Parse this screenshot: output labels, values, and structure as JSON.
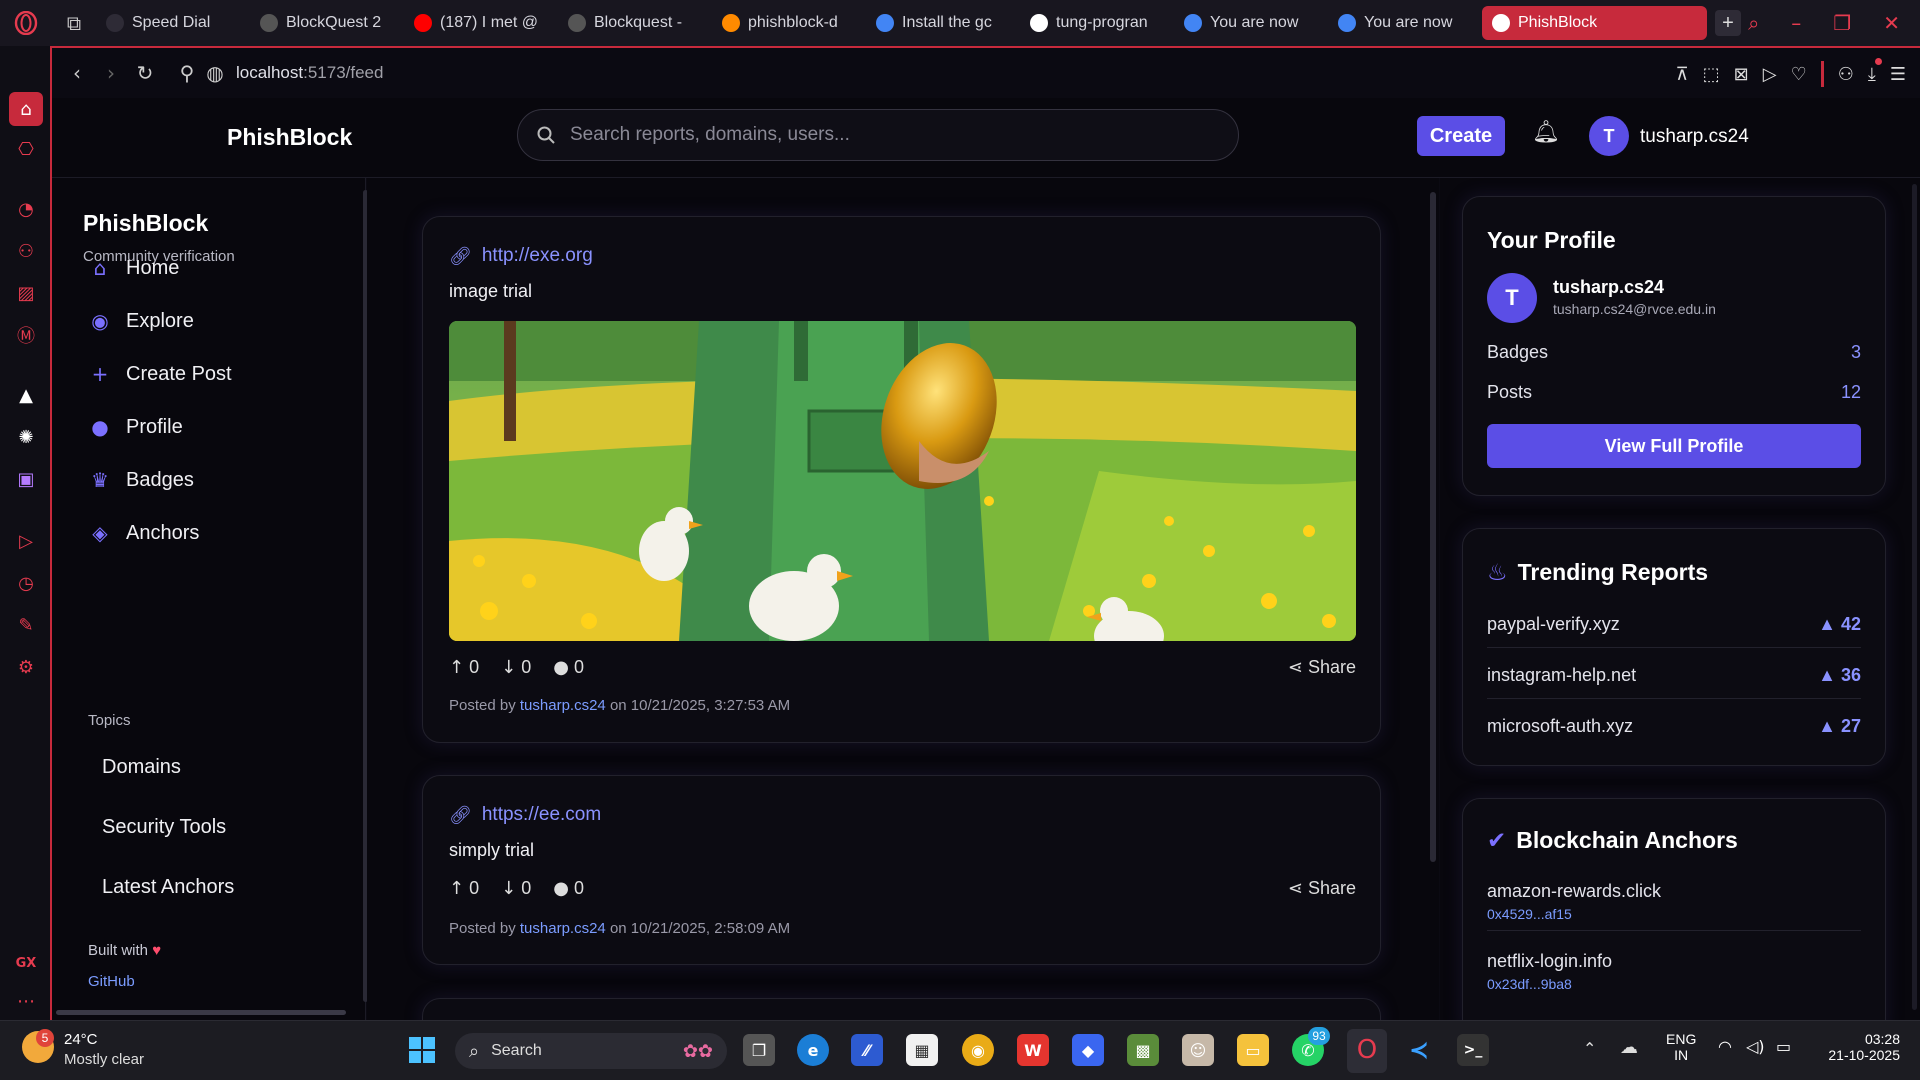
{
  "browser": {
    "tabs": [
      {
        "label": "Speed Dial",
        "icon": "grid-icon",
        "color": "#2e2b36"
      },
      {
        "label": "BlockQuest 2",
        "icon": "openai-icon",
        "color": "#555"
      },
      {
        "label": "(187) I met @",
        "icon": "youtube-icon",
        "color": "#ff0000"
      },
      {
        "label": "Blockquest -",
        "icon": "openai-icon",
        "color": "#555"
      },
      {
        "label": "phishblock-d",
        "icon": "firebase-icon",
        "color": "#ff8a00"
      },
      {
        "label": "Install the gc",
        "icon": "gcloud-icon",
        "color": "#4285f4"
      },
      {
        "label": "tung-progran",
        "icon": "github-icon",
        "color": "#ffffff"
      },
      {
        "label": "You are now",
        "icon": "gcloud-icon",
        "color": "#4285f4"
      },
      {
        "label": "You are now",
        "icon": "gcloud-icon",
        "color": "#4285f4"
      },
      {
        "label": "PhishBlock",
        "icon": "phishblock-icon",
        "color": "#ffffff",
        "active": true
      }
    ],
    "url_host": "localhost",
    "url_path": ":5173/feed"
  },
  "app": {
    "brand": "PhishBlock",
    "search_placeholder": "Search reports, domains, users...",
    "create_label": "Create",
    "user_initial": "T",
    "username": "tusharp.cs24"
  },
  "sidebar": {
    "title": "PhishBlock",
    "subtitle": "Community verification",
    "items": [
      {
        "label": "Home",
        "icon": "home-icon",
        "glyph": "⌂"
      },
      {
        "label": "Explore",
        "icon": "compass-icon",
        "glyph": "◉"
      },
      {
        "label": "Create Post",
        "icon": "plus-icon",
        "glyph": "+"
      },
      {
        "label": "Profile",
        "icon": "user-icon",
        "glyph": "●"
      },
      {
        "label": "Badges",
        "icon": "trophy-icon",
        "glyph": "♛"
      },
      {
        "label": "Anchors",
        "icon": "shield-icon",
        "glyph": "◈"
      }
    ],
    "topics_heading": "Topics",
    "topics": [
      "Domains",
      "Security Tools",
      "Latest Anchors"
    ],
    "built_with": "Built with",
    "github": "GitHub"
  },
  "posts": [
    {
      "link": "http://exe.org",
      "body": "image trial",
      "has_image": true,
      "up": "0",
      "down": "0",
      "comments": "0",
      "share": "Share",
      "posted_prefix": "Posted by",
      "author": "tusharp.cs24",
      "posted_on": "on 10/21/2025, 3:27:53 AM"
    },
    {
      "link": "https://ee.com",
      "body": "simply trial",
      "has_image": false,
      "up": "0",
      "down": "0",
      "comments": "0",
      "share": "Share",
      "posted_prefix": "Posted by",
      "author": "tusharp.cs24",
      "posted_on": "on 10/21/2025, 2:58:09 AM"
    }
  ],
  "profile_card": {
    "title": "Your Profile",
    "initial": "T",
    "name": "tusharp.cs24",
    "email": "tusharp.cs24@rvce.edu.in",
    "badges_label": "Badges",
    "badges_value": "3",
    "posts_label": "Posts",
    "posts_value": "12",
    "button": "View Full Profile"
  },
  "trending": {
    "title": "Trending Reports",
    "items": [
      {
        "domain": "paypal-verify.xyz",
        "score": "▲ 42"
      },
      {
        "domain": "instagram-help.net",
        "score": "▲ 36"
      },
      {
        "domain": "microsoft-auth.xyz",
        "score": "▲ 27"
      }
    ]
  },
  "anchors": {
    "title": "Blockchain Anchors",
    "items": [
      {
        "domain": "amazon-rewards.click",
        "hash": "0x4529...af15"
      },
      {
        "domain": "netflix-login.info",
        "hash": "0x23df...9ba8"
      }
    ]
  },
  "taskbar": {
    "weather_temp": "24°C",
    "weather_desc": "Mostly clear",
    "weather_badge": "5",
    "search_label": "Search",
    "whatsapp_badge": "93",
    "lang_top": "ENG",
    "lang_bottom": "IN",
    "time": "03:28",
    "date": "21-10-2025"
  },
  "colors": {
    "accent": "#5b4ee6",
    "opera_red": "#c72a3c",
    "link": "#8a92ff"
  }
}
